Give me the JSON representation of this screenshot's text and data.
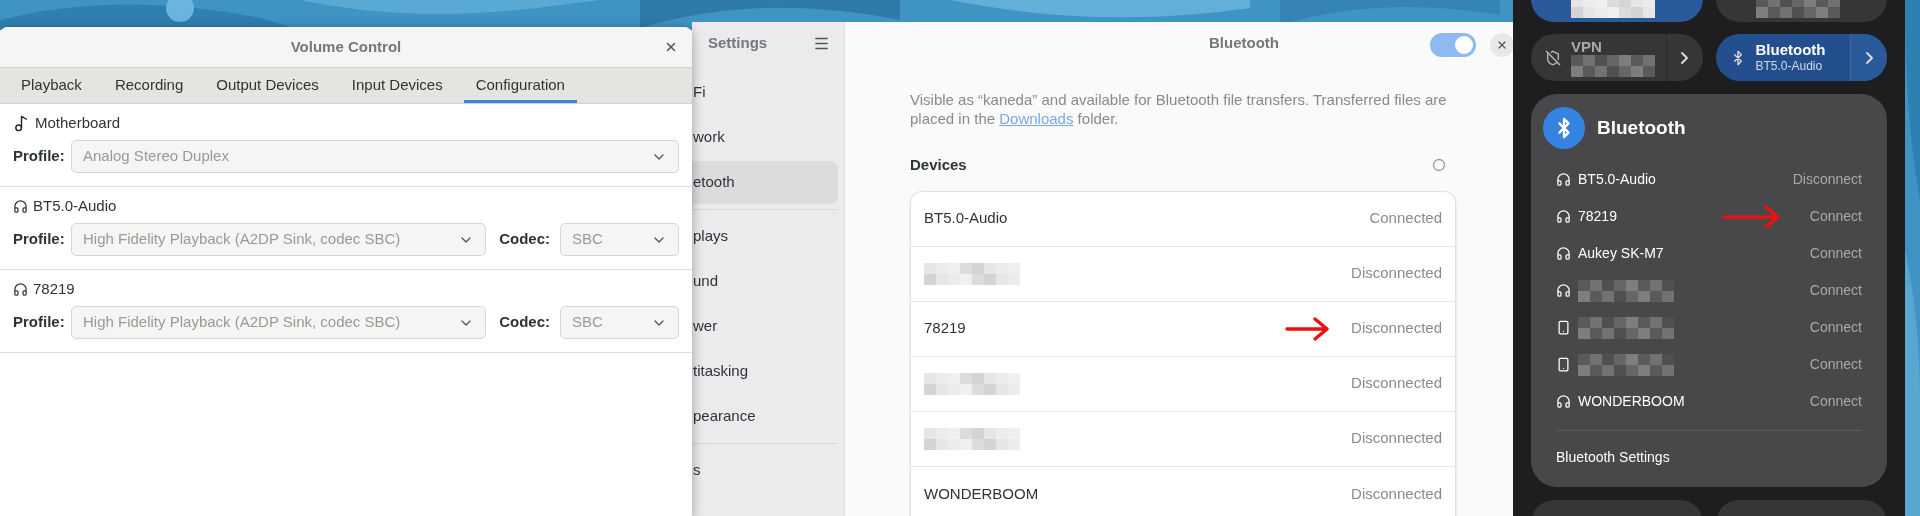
{
  "volume_control": {
    "title": "Volume Control",
    "tabs": [
      {
        "label": "Playback",
        "selected": false
      },
      {
        "label": "Recording",
        "selected": false
      },
      {
        "label": "Output Devices",
        "selected": false
      },
      {
        "label": "Input Devices",
        "selected": false
      },
      {
        "label": "Configuration",
        "selected": true
      }
    ],
    "cards": [
      {
        "kind": "card",
        "name": "Motherboard",
        "profile_label": "Profile:",
        "profile": "Analog Stereo Duplex",
        "disabled": true
      },
      {
        "kind": "headset",
        "name": "BT5.0-Audio",
        "profile_label": "Profile:",
        "profile": "High Fidelity Playback (A2DP Sink, codec SBC)",
        "codec_label": "Codec:",
        "codec": "SBC",
        "disabled": true
      },
      {
        "kind": "headset",
        "name": "78219",
        "profile_label": "Profile:",
        "profile": "High Fidelity Playback (A2DP Sink, codec SBC)",
        "codec_label": "Codec:",
        "codec": "SBC",
        "disabled": true
      }
    ]
  },
  "settings": {
    "title": "Settings",
    "sidebar_groups": [
      [
        {
          "label": "Fi",
          "selected": false
        },
        {
          "label": "work",
          "selected": false
        },
        {
          "label": "etooth",
          "selected": true
        }
      ],
      [
        {
          "label": "plays",
          "selected": false
        },
        {
          "label": "und",
          "selected": false
        },
        {
          "label": "wer",
          "selected": false
        },
        {
          "label": "titasking",
          "selected": false
        },
        {
          "label": "pearance",
          "selected": false
        }
      ],
      [
        {
          "label": "s",
          "selected": false
        }
      ]
    ],
    "page": {
      "title": "Bluetooth",
      "enabled": true,
      "description_before": "Visible as “kaneda” and available for Bluetooth file transfers. Transferred files are placed in the ",
      "link": "Downloads",
      "description_after": " folder.",
      "devices_heading": "Devices",
      "devices": [
        {
          "name": "BT5.0-Audio",
          "status": "Connected",
          "redacted": false,
          "arrow": false
        },
        {
          "status": "Disconnected",
          "redacted": true,
          "arrow": false
        },
        {
          "name": "78219",
          "status": "Disconnected",
          "redacted": false,
          "arrow": true
        },
        {
          "status": "Disconnected",
          "redacted": true,
          "arrow": false
        },
        {
          "status": "Disconnected",
          "redacted": true,
          "arrow": false
        },
        {
          "name": "WONDERBOOM",
          "status": "Disconnected",
          "redacted": false,
          "arrow": false
        }
      ]
    }
  },
  "quick_settings": {
    "toggles": [
      {
        "kind": "vpn",
        "label": "VPN",
        "on": false
      },
      {
        "kind": "bluetooth",
        "label": "Bluetooth",
        "subtitle": "BT5.0-Audio",
        "on": true
      }
    ],
    "menu": {
      "title": "Bluetooth",
      "devices": [
        {
          "kind": "headset",
          "name": "BT5.0-Audio",
          "action": "Disconnect",
          "redacted": false,
          "arrow": false
        },
        {
          "kind": "headset",
          "name": "78219",
          "action": "Connect",
          "redacted": false,
          "arrow": true
        },
        {
          "kind": "headset",
          "name": "Aukey SK-M7",
          "action": "Connect",
          "redacted": false,
          "arrow": false
        },
        {
          "kind": "headset",
          "action": "Connect",
          "redacted": true,
          "arrow": false
        },
        {
          "kind": "phone",
          "action": "Connect",
          "redacted": true,
          "arrow": false
        },
        {
          "kind": "phone",
          "action": "Connect",
          "redacted": true,
          "arrow": false
        },
        {
          "kind": "headset",
          "name": "WONDERBOOM",
          "action": "Connect",
          "redacted": false,
          "arrow": false
        }
      ],
      "settings_link": "Bluetooth Settings"
    }
  }
}
